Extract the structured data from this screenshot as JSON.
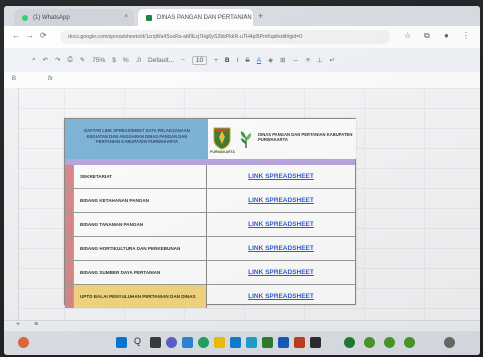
{
  "browser": {
    "tabs": [
      {
        "label": "(1) WhatsApp",
        "favicon_color": "#25d366"
      },
      {
        "label": "DINAS PANGAN DAN PERTANIAN",
        "favicon_color": "#188038"
      }
    ],
    "new_tab": "+",
    "close": "×",
    "url": "docs.google.com/spreadsheets/d/1crqWa4SoxRs-aM9Lq7Hg0yS2bkPkkR-uTH4pl5PmKqd/edit#gid=0"
  },
  "toolbar": {
    "zoom": "75%",
    "font": "Default...",
    "font_size": "10",
    "bold": "B",
    "italic": "I",
    "strike": "S",
    "text_color": "A"
  },
  "formula_bar": {
    "cell_ref": "B",
    "fx": "fx"
  },
  "sheet": {
    "banner_left": "DAFTAR LINK SPREADSHEET DATA PELAKSANAAN KEGIATAN DAN ANGGARAN DINAS PANGAN DAN PERTANIAN KABUPATEN PURWAKARTA",
    "crest_label": "PURWAKARTA",
    "banner_right": "DINAS PANGAN DAN PERTANIAN KABUPATEN PURWAKARTA",
    "rows": [
      {
        "department": "SEKRETARIAT",
        "link": "LINK SPREADSHEET"
      },
      {
        "department": "BIDANG KETAHANAN PANGAN",
        "link": "LINK SPREADSHEET"
      },
      {
        "department": "BIDANG TANAMAN PANGAN",
        "link": "LINK SPREADSHEET"
      },
      {
        "department": "BIDANG HORTIKULTURA DAN PERKEBUNAN",
        "link": "LINK SPREADSHEET"
      },
      {
        "department": "BIDANG SUMBER DAYA PERTANIAN",
        "link": "LINK SPREADSHEET"
      },
      {
        "department": "UPTD BALAI PENYULUHAN PERTANIAN DAN DINAS",
        "link": "LINK SPREADSHEET"
      }
    ]
  },
  "sheet_tabs": {
    "add": "+",
    "menu": "≡"
  },
  "taskbar": {
    "search_glyph": "Q"
  },
  "colors": {
    "banner_blue": "#7db4d8",
    "strip_purple": "#b7a6e0",
    "number_cell": "#d98787",
    "highlight_yellow": "#f6d87e",
    "link_blue": "#2f5fd0"
  }
}
